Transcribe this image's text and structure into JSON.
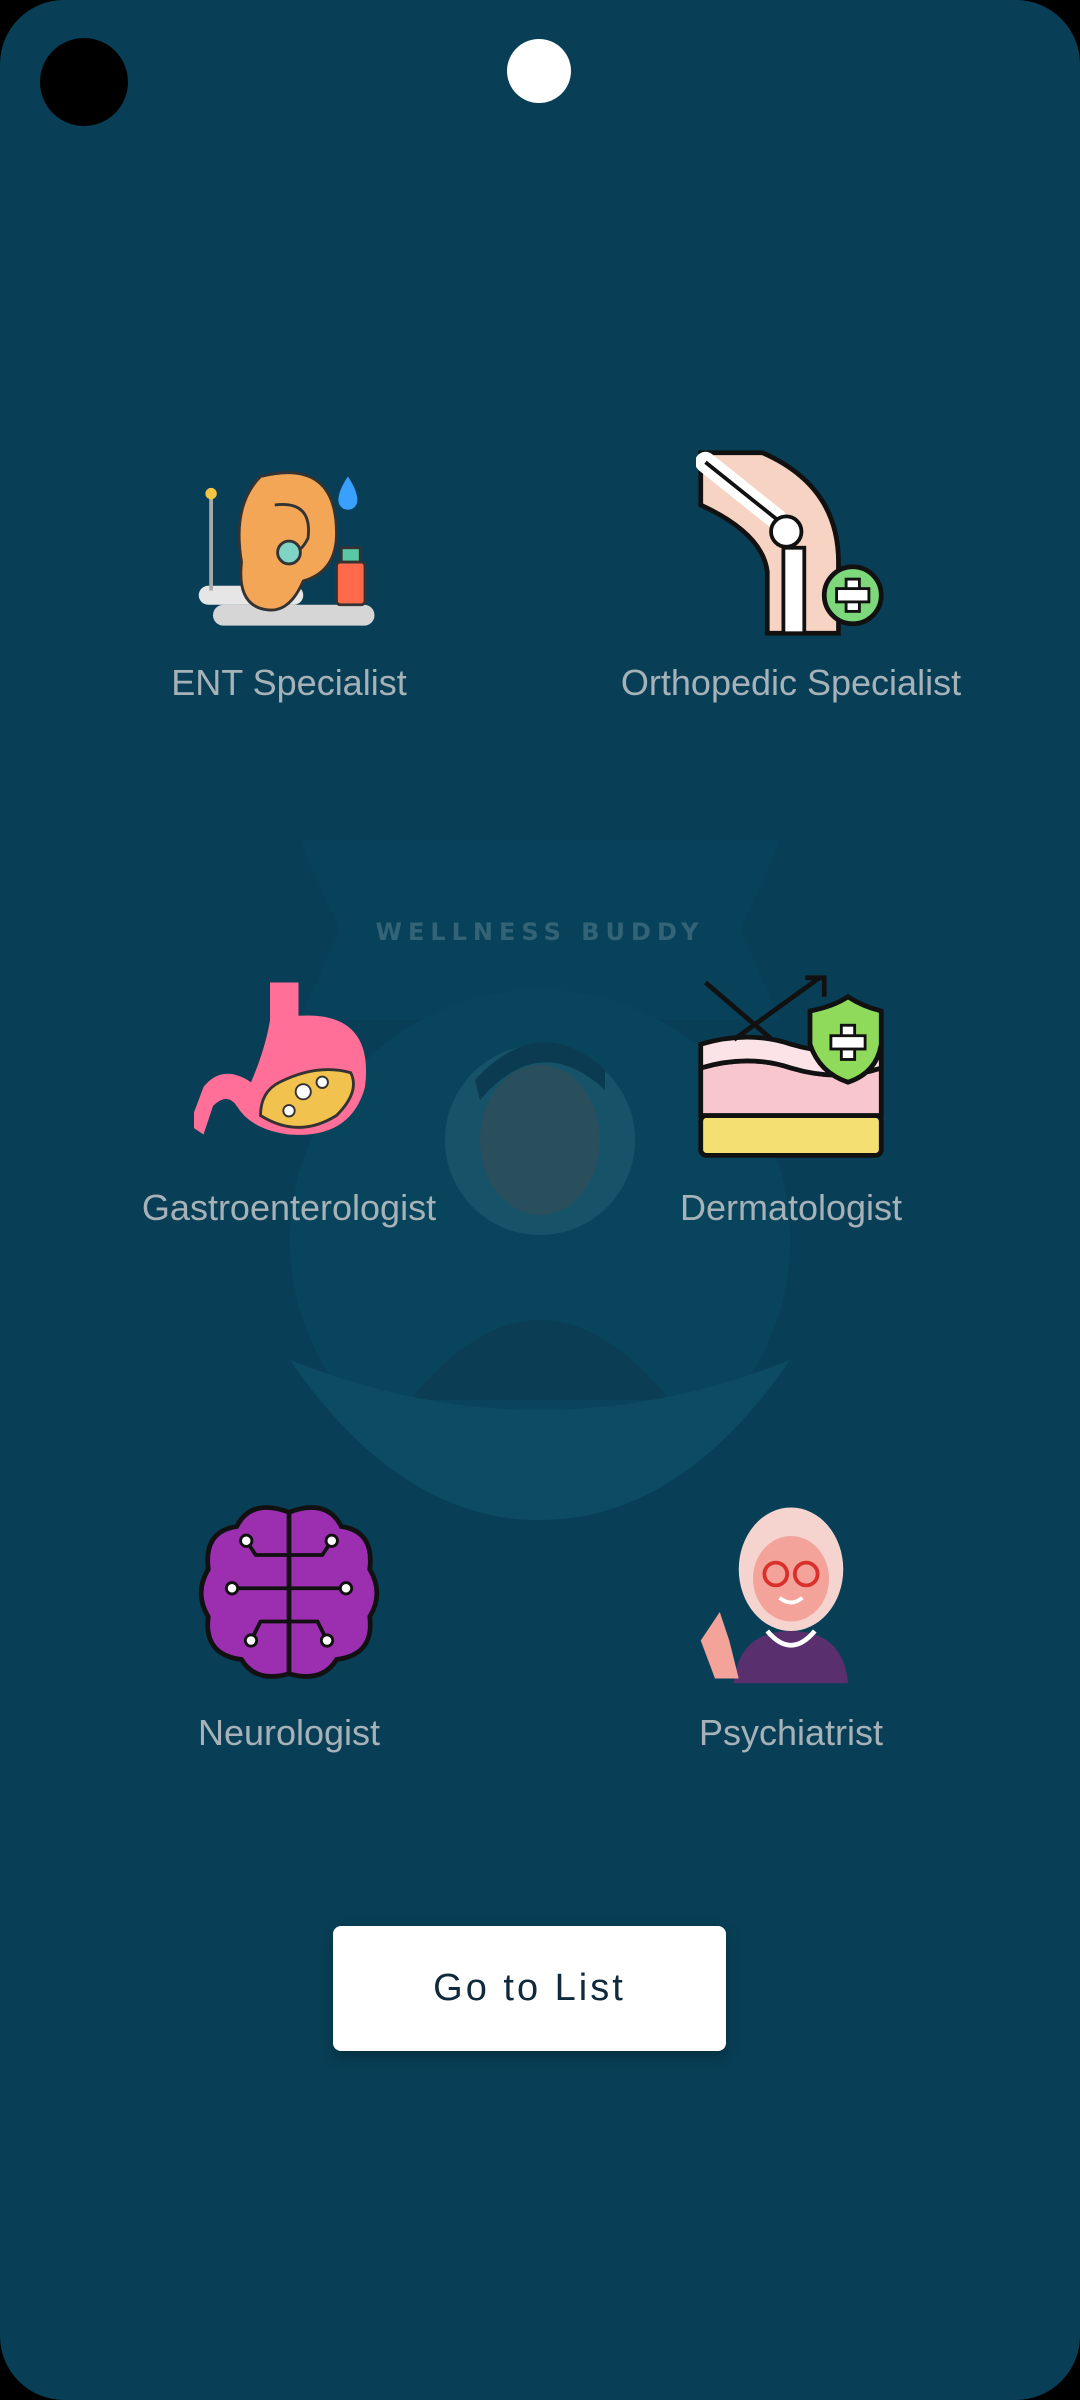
{
  "specialists": [
    {
      "label": "ENT Specialist",
      "icon": "ear-icon"
    },
    {
      "label": "Orthopedic Specialist",
      "icon": "knee-joint-icon"
    },
    {
      "label": "Gastroenterologist",
      "icon": "stomach-icon"
    },
    {
      "label": "Dermatologist",
      "icon": "skin-layers-shield-icon"
    },
    {
      "label": "Neurologist",
      "icon": "brain-icon"
    },
    {
      "label": "Psychiatrist",
      "icon": "doctor-avatar-icon"
    }
  ],
  "background": {
    "watermark_text": "WELLNESS BUDDY"
  },
  "actions": {
    "go_to_list_label": "Go to List"
  },
  "colors": {
    "background": "#083f56",
    "label": "#a7b2b8",
    "button_bg": "#ffffff",
    "button_text": "#0f2a3a"
  }
}
